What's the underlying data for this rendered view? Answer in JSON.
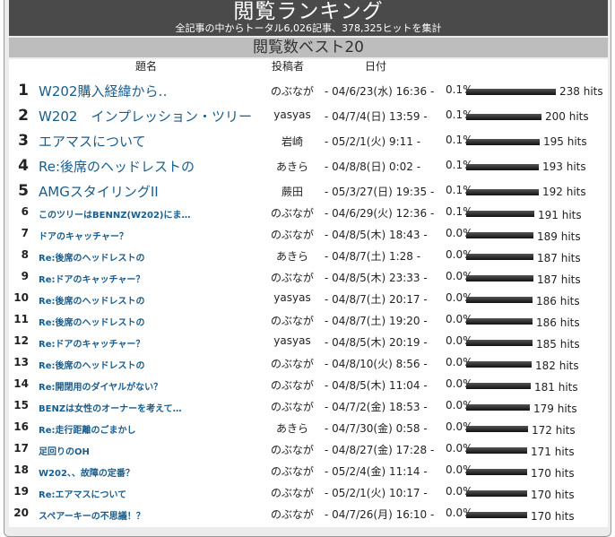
{
  "header": {
    "title": "閲覧ランキング",
    "subtitle": "全記事の中からトータル6,026記事、378,325ヒットを集計"
  },
  "section": {
    "title": "閲覧数ベスト20"
  },
  "columns": {
    "topic": "題名",
    "author": "投稿者",
    "date": "日付"
  },
  "rows": [
    {
      "rank": "1",
      "topic": "W202購入経緯から‥",
      "author": "のぶなが",
      "date": "- 04/6/23(水) 16:36 -",
      "percent": "0.1%",
      "hits": "238 hits"
    },
    {
      "rank": "2",
      "topic": "W202　インプレッション・ツリー",
      "author": "yasyas",
      "date": "- 04/7/4(日) 13:59 -",
      "percent": "0.1%",
      "hits": "200 hits"
    },
    {
      "rank": "3",
      "topic": "エアマスについて",
      "author": "岩崎",
      "date": "- 05/2/1(火) 9:11 -",
      "percent": "0.1%",
      "hits": "195 hits"
    },
    {
      "rank": "4",
      "topic": "Re:後席のヘッドレストの",
      "author": "あきら",
      "date": "- 04/8/8(日) 0:02 -",
      "percent": "0.1%",
      "hits": "193 hits"
    },
    {
      "rank": "5",
      "topic": "AMGスタイリングII",
      "author": "蕨田",
      "date": "- 05/3/27(日) 19:35 -",
      "percent": "0.1%",
      "hits": "192 hits"
    },
    {
      "rank": "6",
      "topic": "このツリーはBENNZ(W202)にま…",
      "author": "のぶなが",
      "date": "- 04/6/29(火) 12:36 -",
      "percent": "0.1%",
      "hits": "191 hits"
    },
    {
      "rank": "7",
      "topic": "ドアのキャッチャー？",
      "author": "のぶなが",
      "date": "- 04/8/5(木) 18:43 -",
      "percent": "0.0%",
      "hits": "189 hits"
    },
    {
      "rank": "8",
      "topic": "Re:後席のヘッドレストの",
      "author": "あきら",
      "date": "- 04/8/7(土) 1:28 -",
      "percent": "0.0%",
      "hits": "187 hits"
    },
    {
      "rank": "9",
      "topic": "Re:ドアのキャッチャー？",
      "author": "のぶなが",
      "date": "- 04/8/5(木) 23:33 -",
      "percent": "0.0%",
      "hits": "187 hits"
    },
    {
      "rank": "10",
      "topic": "Re:後席のヘッドレストの",
      "author": "yasyas",
      "date": "- 04/8/7(土) 20:17 -",
      "percent": "0.0%",
      "hits": "186 hits"
    },
    {
      "rank": "11",
      "topic": "Re:後席のヘッドレストの",
      "author": "のぶなが",
      "date": "- 04/8/7(土) 19:20 -",
      "percent": "0.0%",
      "hits": "186 hits"
    },
    {
      "rank": "12",
      "topic": "Re:ドアのキャッチャー？",
      "author": "yasyas",
      "date": "- 04/8/5(木) 20:19 -",
      "percent": "0.0%",
      "hits": "185 hits"
    },
    {
      "rank": "13",
      "topic": "Re:後席のヘッドレストの",
      "author": "のぶなが",
      "date": "- 04/8/10(火) 8:56 -",
      "percent": "0.0%",
      "hits": "182 hits"
    },
    {
      "rank": "14",
      "topic": "Re:開閉用のダイヤルがない？",
      "author": "のぶなが",
      "date": "- 04/8/5(木) 11:04 -",
      "percent": "0.0%",
      "hits": "181 hits"
    },
    {
      "rank": "15",
      "topic": "BENZは女性のオーナーを考えて…",
      "author": "のぶなが",
      "date": "- 04/7/2(金) 18:53 -",
      "percent": "0.0%",
      "hits": "179 hits"
    },
    {
      "rank": "16",
      "topic": "Re:走行距離のごまかし",
      "author": "あきら",
      "date": "- 04/7/30(金) 0:58 -",
      "percent": "0.0%",
      "hits": "172 hits"
    },
    {
      "rank": "17",
      "topic": "足回りのOH",
      "author": "のぶなが",
      "date": "- 04/8/27(金) 17:28 -",
      "percent": "0.0%",
      "hits": "171 hits"
    },
    {
      "rank": "18",
      "topic": "W202、、故障の定番？",
      "author": "のぶなが",
      "date": "- 05/2/4(金) 11:14 -",
      "percent": "0.0%",
      "hits": "170 hits"
    },
    {
      "rank": "19",
      "topic": "Re:エアマスについて",
      "author": "のぶなが",
      "date": "- 05/2/1(火) 10:17 -",
      "percent": "0.0%",
      "hits": "170 hits"
    },
    {
      "rank": "20",
      "topic": "スペアーキーの不思議！？",
      "author": "のぶなが",
      "date": "- 04/7/26(月) 16:10 -",
      "percent": "0.0%",
      "hits": "170 hits"
    }
  ]
}
